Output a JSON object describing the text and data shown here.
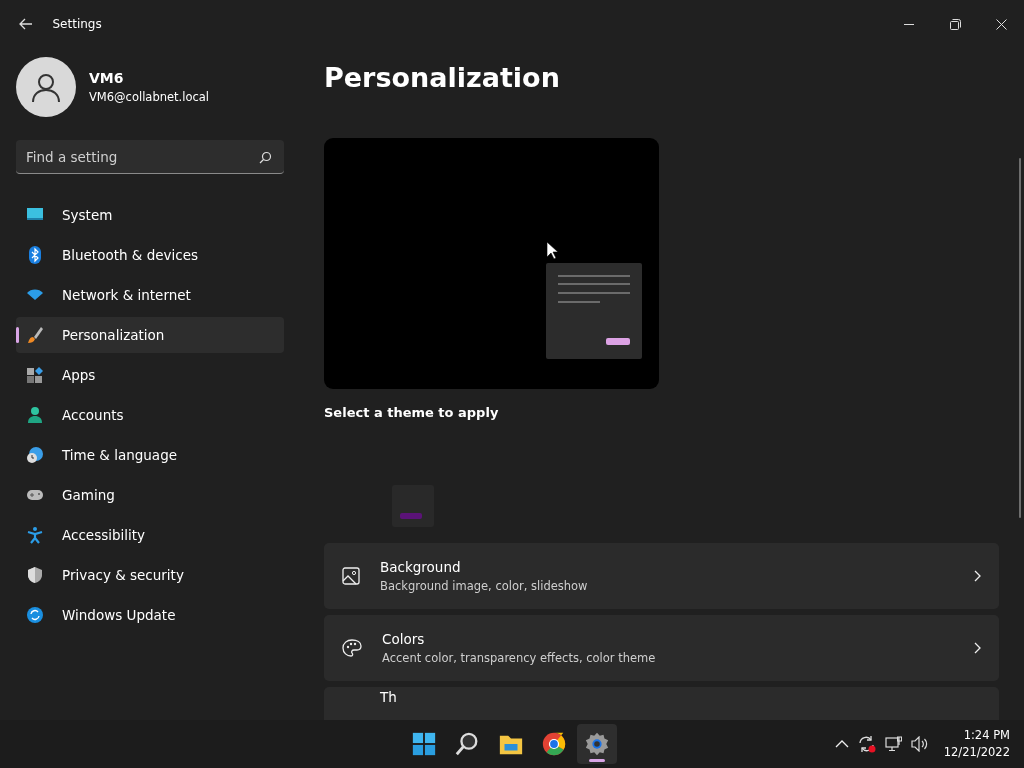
{
  "window": {
    "title": "Settings"
  },
  "account": {
    "name": "VM6",
    "email": "VM6@collabnet.local"
  },
  "search": {
    "placeholder": "Find a setting"
  },
  "sidebar": {
    "items": [
      {
        "label": "System",
        "selected": false
      },
      {
        "label": "Bluetooth & devices",
        "selected": false
      },
      {
        "label": "Network & internet",
        "selected": false
      },
      {
        "label": "Personalization",
        "selected": true
      },
      {
        "label": "Apps",
        "selected": false
      },
      {
        "label": "Accounts",
        "selected": false
      },
      {
        "label": "Time & language",
        "selected": false
      },
      {
        "label": "Gaming",
        "selected": false
      },
      {
        "label": "Accessibility",
        "selected": false
      },
      {
        "label": "Privacy & security",
        "selected": false
      },
      {
        "label": "Windows Update",
        "selected": false
      }
    ]
  },
  "page": {
    "title": "Personalization",
    "theme_caption": "Select a theme to apply",
    "cards": [
      {
        "title": "Background",
        "subtitle": "Background image, color, slideshow"
      },
      {
        "title": "Colors",
        "subtitle": "Accent color, transparency effects, color theme"
      },
      {
        "title": "Th"
      }
    ]
  },
  "taskbar": {
    "apps": [
      {
        "selected": false
      },
      {
        "selected": false
      },
      {
        "selected": false
      },
      {
        "selected": false
      },
      {
        "selected": true
      }
    ],
    "time": "1:24 PM",
    "date": "12/21/2022"
  }
}
